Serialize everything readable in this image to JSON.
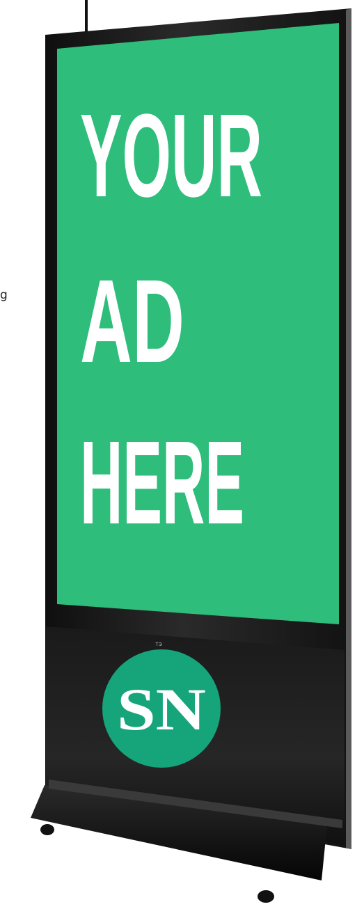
{
  "fragment_text": "g",
  "ad": {
    "line1": "YOUR",
    "line2": "AD",
    "line3": "HERE"
  },
  "logo": {
    "text": "SN"
  },
  "brand_text": "ТЭ",
  "colors": {
    "screen_green": "#2ebd7b",
    "logo_green": "#16a57a",
    "frame_dark": "#1b1b1b"
  },
  "icons": [
    "logo-badge-icon"
  ]
}
